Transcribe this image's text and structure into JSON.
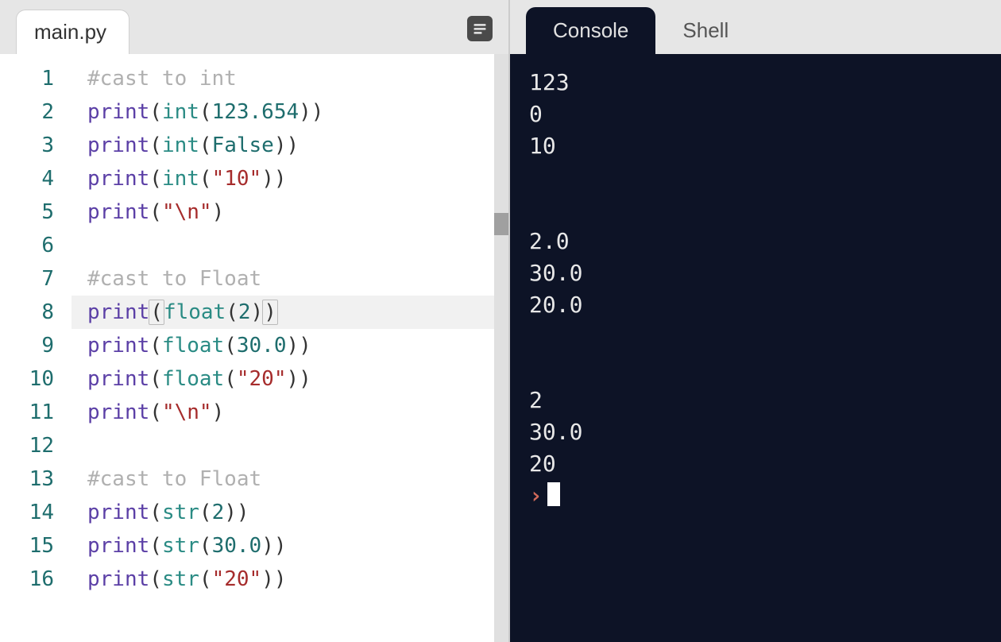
{
  "editor": {
    "filename": "main.py",
    "active_line": 8,
    "lines": [
      {
        "n": 1,
        "tokens": [
          {
            "t": "#cast to int",
            "c": "comment"
          }
        ]
      },
      {
        "n": 2,
        "tokens": [
          {
            "t": "print",
            "c": "builtin"
          },
          {
            "t": "(",
            "c": "punct"
          },
          {
            "t": "int",
            "c": "func"
          },
          {
            "t": "(",
            "c": "punct"
          },
          {
            "t": "123.654",
            "c": "number"
          },
          {
            "t": ")",
            "c": "punct"
          },
          {
            "t": ")",
            "c": "punct"
          }
        ]
      },
      {
        "n": 3,
        "tokens": [
          {
            "t": "print",
            "c": "builtin"
          },
          {
            "t": "(",
            "c": "punct"
          },
          {
            "t": "int",
            "c": "func"
          },
          {
            "t": "(",
            "c": "punct"
          },
          {
            "t": "False",
            "c": "keyword"
          },
          {
            "t": ")",
            "c": "punct"
          },
          {
            "t": ")",
            "c": "punct"
          }
        ]
      },
      {
        "n": 4,
        "tokens": [
          {
            "t": "print",
            "c": "builtin"
          },
          {
            "t": "(",
            "c": "punct"
          },
          {
            "t": "int",
            "c": "func"
          },
          {
            "t": "(",
            "c": "punct"
          },
          {
            "t": "\"10\"",
            "c": "string"
          },
          {
            "t": ")",
            "c": "punct"
          },
          {
            "t": ")",
            "c": "punct"
          }
        ]
      },
      {
        "n": 5,
        "tokens": [
          {
            "t": "print",
            "c": "builtin"
          },
          {
            "t": "(",
            "c": "punct"
          },
          {
            "t": "\"\\n\"",
            "c": "string"
          },
          {
            "t": ")",
            "c": "punct"
          }
        ]
      },
      {
        "n": 6,
        "tokens": []
      },
      {
        "n": 7,
        "tokens": [
          {
            "t": "#cast to Float",
            "c": "comment"
          }
        ]
      },
      {
        "n": 8,
        "tokens": [
          {
            "t": "print",
            "c": "builtin"
          },
          {
            "t": "(",
            "c": "punct",
            "box": true
          },
          {
            "t": "float",
            "c": "func"
          },
          {
            "t": "(",
            "c": "punct"
          },
          {
            "t": "2",
            "c": "number"
          },
          {
            "t": ")",
            "c": "punct"
          },
          {
            "t": ")",
            "c": "punct",
            "box": true
          }
        ]
      },
      {
        "n": 9,
        "tokens": [
          {
            "t": "print",
            "c": "builtin"
          },
          {
            "t": "(",
            "c": "punct"
          },
          {
            "t": "float",
            "c": "func"
          },
          {
            "t": "(",
            "c": "punct"
          },
          {
            "t": "30.0",
            "c": "number"
          },
          {
            "t": ")",
            "c": "punct"
          },
          {
            "t": ")",
            "c": "punct"
          }
        ]
      },
      {
        "n": 10,
        "tokens": [
          {
            "t": "print",
            "c": "builtin"
          },
          {
            "t": "(",
            "c": "punct"
          },
          {
            "t": "float",
            "c": "func"
          },
          {
            "t": "(",
            "c": "punct"
          },
          {
            "t": "\"20\"",
            "c": "string"
          },
          {
            "t": ")",
            "c": "punct"
          },
          {
            "t": ")",
            "c": "punct"
          }
        ]
      },
      {
        "n": 11,
        "tokens": [
          {
            "t": "print",
            "c": "builtin"
          },
          {
            "t": "(",
            "c": "punct"
          },
          {
            "t": "\"\\n\"",
            "c": "string"
          },
          {
            "t": ")",
            "c": "punct"
          }
        ]
      },
      {
        "n": 12,
        "tokens": []
      },
      {
        "n": 13,
        "tokens": [
          {
            "t": "#cast to Float",
            "c": "comment"
          }
        ]
      },
      {
        "n": 14,
        "tokens": [
          {
            "t": "print",
            "c": "builtin"
          },
          {
            "t": "(",
            "c": "punct"
          },
          {
            "t": "str",
            "c": "func"
          },
          {
            "t": "(",
            "c": "punct"
          },
          {
            "t": "2",
            "c": "number"
          },
          {
            "t": ")",
            "c": "punct"
          },
          {
            "t": ")",
            "c": "punct"
          }
        ]
      },
      {
        "n": 15,
        "tokens": [
          {
            "t": "print",
            "c": "builtin"
          },
          {
            "t": "(",
            "c": "punct"
          },
          {
            "t": "str",
            "c": "func"
          },
          {
            "t": "(",
            "c": "punct"
          },
          {
            "t": "30.0",
            "c": "number"
          },
          {
            "t": ")",
            "c": "punct"
          },
          {
            "t": ")",
            "c": "punct"
          }
        ]
      },
      {
        "n": 16,
        "tokens": [
          {
            "t": "print",
            "c": "builtin"
          },
          {
            "t": "(",
            "c": "punct"
          },
          {
            "t": "str",
            "c": "func"
          },
          {
            "t": "(",
            "c": "punct"
          },
          {
            "t": "\"20\"",
            "c": "string"
          },
          {
            "t": ")",
            "c": "punct"
          },
          {
            "t": ")",
            "c": "punct"
          }
        ]
      }
    ]
  },
  "right": {
    "tabs": {
      "console": "Console",
      "shell": "Shell",
      "active": "console"
    },
    "output_lines": [
      "123",
      "0",
      "10",
      "",
      "",
      "2.0",
      "30.0",
      "20.0",
      "",
      "",
      "2",
      "30.0",
      "20"
    ],
    "prompt_glyph": "›"
  }
}
